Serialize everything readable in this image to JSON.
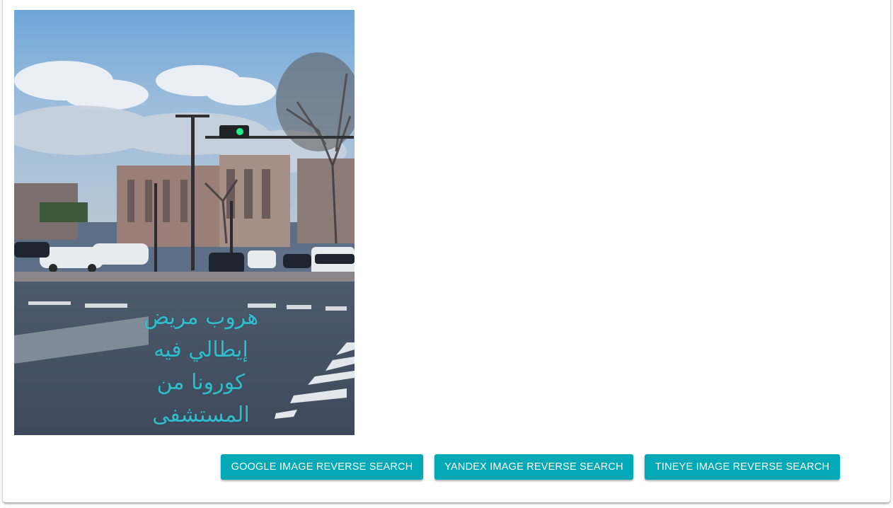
{
  "media": {
    "caption_lines": [
      "هروب مريض",
      "إيطالي فيه",
      "كورونا من",
      "المستشفى"
    ],
    "caption_color": "#2fc7d3"
  },
  "actions": {
    "google_label": "GOOGLE IMAGE REVERSE SEARCH",
    "yandex_label": "YANDEX IMAGE REVERSE SEARCH",
    "tineye_label": "TINEYE IMAGE REVERSE SEARCH",
    "button_color": "#00a9b5"
  }
}
